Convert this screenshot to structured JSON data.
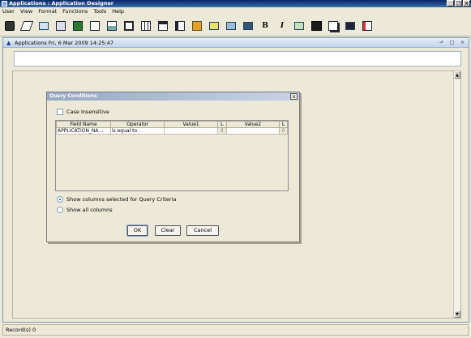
{
  "window": {
    "title": "Applications : Application Designer",
    "buttons": [
      "_",
      "×"
    ],
    "restore_glyph": "❐"
  },
  "menu": [
    "User",
    "View",
    "Format",
    "Functions",
    "Tools",
    "Help"
  ],
  "toolbar": {
    "icons": [
      "connect-icon",
      "eraser-icon",
      "query-icon",
      "save-icon",
      "export-icon",
      "print-icon",
      "grid-icon",
      "preview-icon",
      "columns-icon",
      "panel-icon",
      "chart-icon",
      "report-icon",
      "paint-icon",
      "brush-icon",
      "bold-icon",
      "italic-icon",
      "image-icon",
      "dark-icon",
      "copy-icon",
      "layout-icon",
      "align-icon"
    ],
    "bold_label": "B",
    "italic_label": "I"
  },
  "panel": {
    "title": "Applications Fri, 6 Mar 2009 14:25:47",
    "buttons": [
      "⬏",
      "□",
      "×"
    ]
  },
  "dialog": {
    "title": "Query Conditions",
    "close": "x",
    "case_insensitive": "Case Insensitive",
    "columns": [
      "Field Name",
      "Operator",
      "Value1",
      "L",
      "Value2",
      "L"
    ],
    "rows": [
      {
        "field": "APPLICATION_NA...",
        "operator": "is equal to",
        "value1": "",
        "value2": ""
      }
    ],
    "radio_selected": "Show columns selected for Query Criteria",
    "radio_all": "Show all columns",
    "ok": "OK",
    "clear": "Clear",
    "cancel": "Cancel"
  },
  "status": "Record(s) 0"
}
